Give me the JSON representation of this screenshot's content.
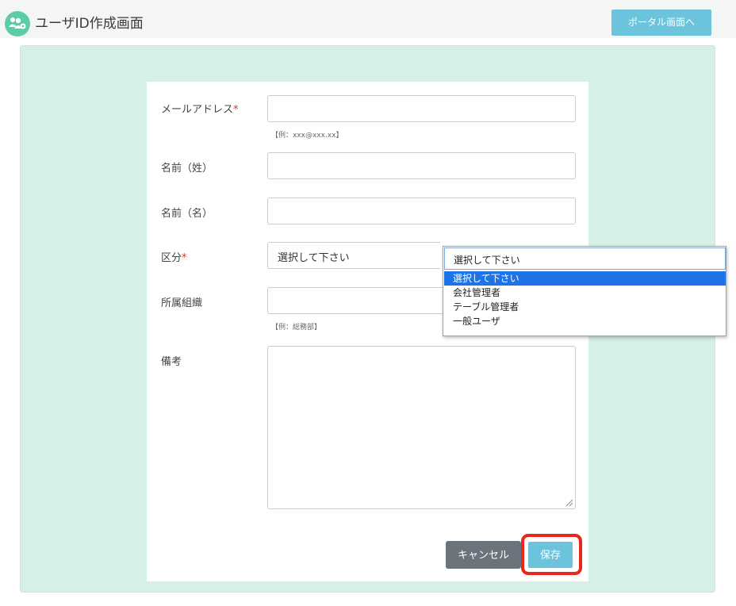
{
  "header": {
    "icon": "users-gear-icon",
    "title": "ユーザID作成画面",
    "portal_button": "ポータル画面へ"
  },
  "form": {
    "email": {
      "label": "メールアドレス",
      "required": "*",
      "value": "",
      "hint": "【例：xxx@xxx.xx】"
    },
    "last_name": {
      "label": "名前（姓）",
      "value": ""
    },
    "first_name": {
      "label": "名前（名）",
      "value": ""
    },
    "category": {
      "label": "区分",
      "required": "*",
      "selected": "選択して下さい",
      "options": [
        "選択して下さい",
        "会社管理者",
        "テーブル管理者",
        "一般ユーザ"
      ],
      "highlighted_option": "選択して下さい"
    },
    "organization": {
      "label": "所属組織",
      "value": "",
      "hint": "【例：総務部】"
    },
    "remarks": {
      "label": "備考",
      "value": ""
    }
  },
  "buttons": {
    "cancel": "キャンセル",
    "save": "保存"
  },
  "colors": {
    "accent": "#6cc3dc",
    "panel_bg": "#d6efe7",
    "required": "#d9312b",
    "highlight_box": "#e8271e",
    "option_selected": "#1e74e6"
  }
}
